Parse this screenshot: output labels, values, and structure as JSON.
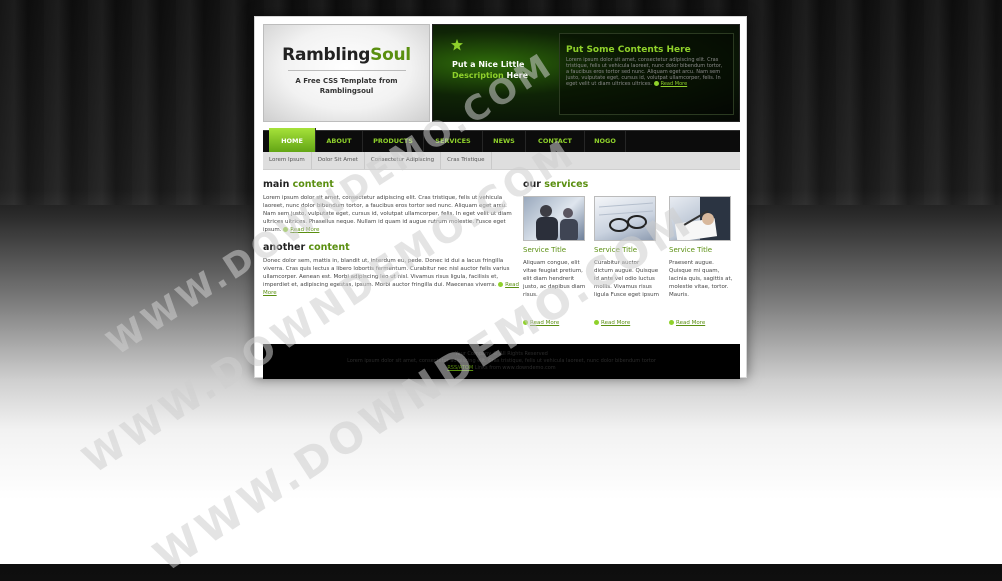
{
  "header": {
    "logo_main": "Rambling",
    "logo_accent": "Soul",
    "logo_sub_line1": "A Free CSS Template from",
    "logo_sub_line2": "Ramblingsoul",
    "tagline_line1": "Put a Nice Little",
    "tagline_g": "Description",
    "tagline_w": " Here",
    "hero_title": "Put Some Contents Here",
    "hero_text": "Lorem ipsum dolor sit amet, consectetur adipiscing elit. Cras tristique, felis ut vehicula laoreet, nunc dolor bibendum tortor, a faucibus eros tortor sed nunc. Aliquam eget arcu. Nam sem justo, vulputate eget, cursus id, volutpat ullamcorper, felis. In eget velit ut diam ultrices ultrices.",
    "hero_read_more": "Read More"
  },
  "nav": {
    "items": [
      "HOME",
      "ABOUT",
      "PRODUCTS",
      "SERVICES",
      "NEWS",
      "CONTACT",
      "NOGO"
    ],
    "active": "HOME"
  },
  "subnav": {
    "items": [
      "Lorem Ipsum",
      "Dolor Sit Amet",
      "Consectetur Adipiscing",
      "Cras Tristique"
    ]
  },
  "main": {
    "title_a": "main ",
    "title_b": "content",
    "text": "Lorem ipsum dolor sit amet, consectetur adipiscing elit. Cras tristique, felis ut vehicula laoreet, nunc dolor bibendum tortor, a faucibus eros tortor sed nunc. Aliquam eget arcu. Nam sem justo, vulputate eget, cursus id, volutpat ullamcorper, felis. In eget velit ut diam ultrices ultrices. Phasellus neque. Nullam id quam id augue rutrum molestie. Fusce eget ipsum.",
    "read_more": "Read More"
  },
  "another": {
    "title_a": "another ",
    "title_b": "content",
    "text": "Donec dolor sem, mattis in, blandit ut, interdum eu, pede. Donec id dui a lacus fringilla viverra. Cras quis lectus a libero lobortis fermentum. Curabitur nec nisl auctor felis varius ullamcorper. Aenean est. Morbi adipiscing leo ut nisl. Vivamus risus ligula, facilisis et, imperdiet et, adipiscing egestas, ipsum. Morbi auctor fringilla dui. Maecenas viverra.",
    "read_more": "Read More"
  },
  "services": {
    "title_a": "our ",
    "title_b": "services",
    "items": [
      {
        "title": "Service Title",
        "text": "Aliquam congue, elit vitae feugiat pretium, elit diam hendrerit justo, ac dapibus diam risus.",
        "read_more": "Read More"
      },
      {
        "title": "Service Title",
        "text": "Curabitur auctor dictum augue. Quisque id ante vel odio luctus mollis. Vivamus risus ligula Fusce eget ipsum",
        "read_more": "Read More"
      },
      {
        "title": "Service Title",
        "text": "Praesent augue. Quisque mi quam, lacinia quis, sagittis at, molestie vitae, tortor. Mauris.",
        "read_more": "Read More"
      }
    ]
  },
  "footer": {
    "line1": "Your Company © All Rights Reserved",
    "line2": "Lorem ipsum dolor sit amet, consectetur adipiscing elit. Cras tristique, felis ut vehicula laoreet, nunc dolor bibendum tortor",
    "line3_link": "RSS/ATOM",
    "line3_rest": " Links from www.downdemo.com"
  },
  "watermark": {
    "text": "WWW.DOWNDEMO.COM"
  },
  "colors": {
    "accent": "#8fd12b",
    "accent_dark": "#5a8f10",
    "nav_bg": "#0c0c0c"
  }
}
